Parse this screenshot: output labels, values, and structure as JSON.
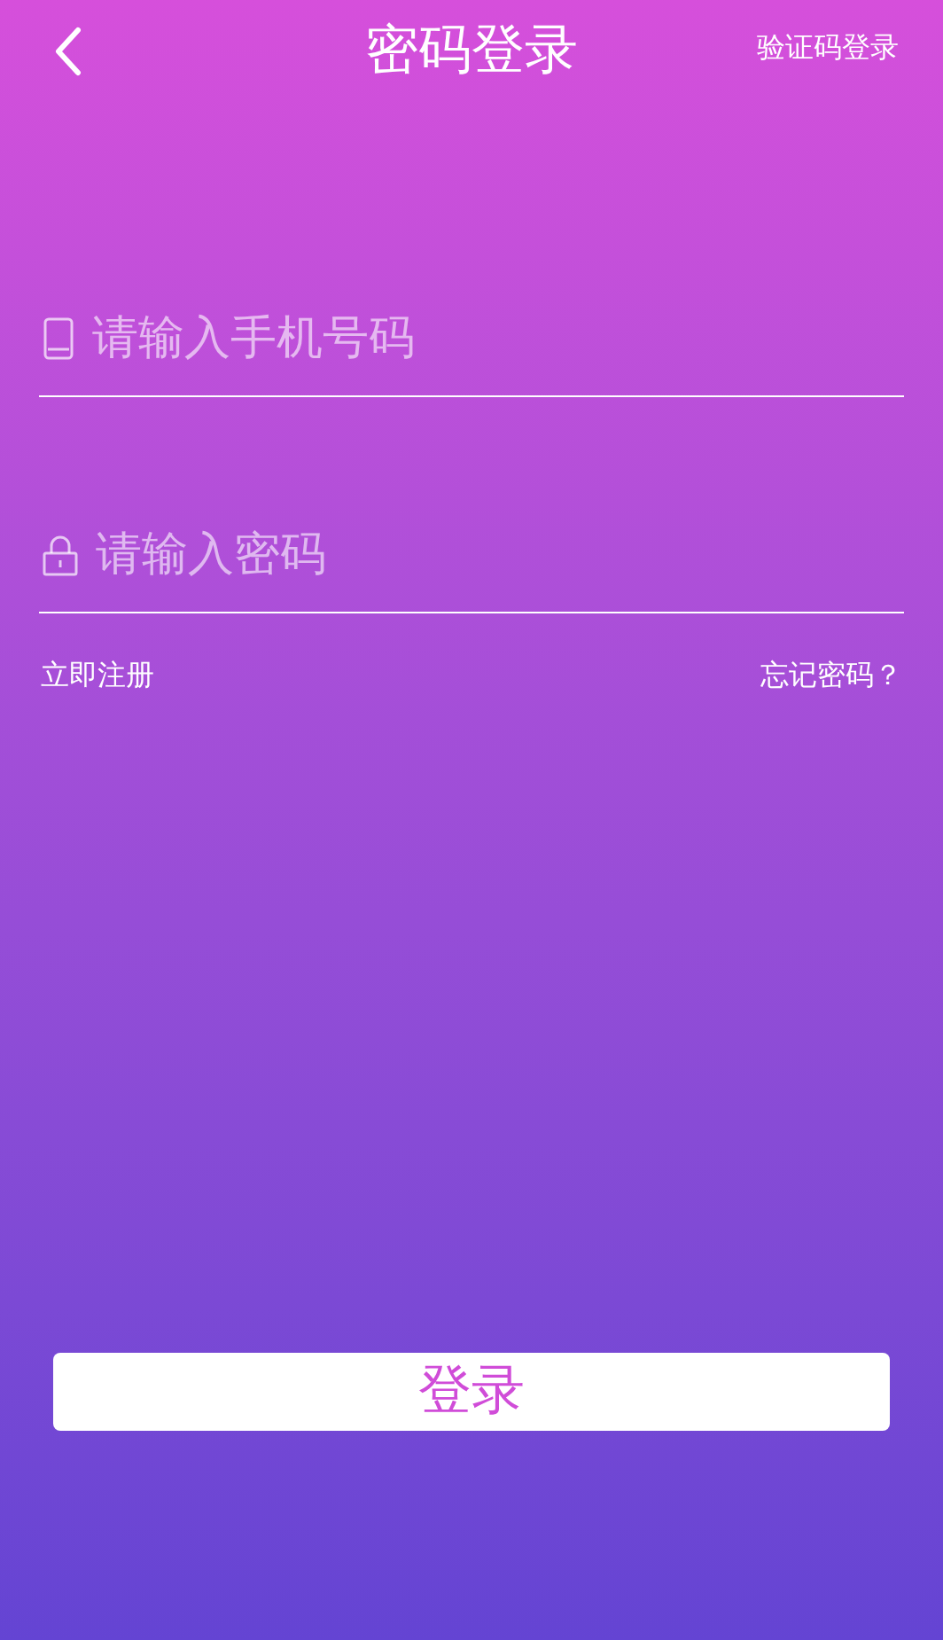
{
  "header": {
    "title": "密码登录",
    "switch_link": "验证码登录"
  },
  "fields": [
    {
      "kind": "phone",
      "placeholder": "请输入手机号码"
    },
    {
      "kind": "password",
      "placeholder": "请输入密码"
    }
  ],
  "links": {
    "register": "立即注册",
    "forgot": "忘记密码？"
  },
  "login_button": "登录"
}
